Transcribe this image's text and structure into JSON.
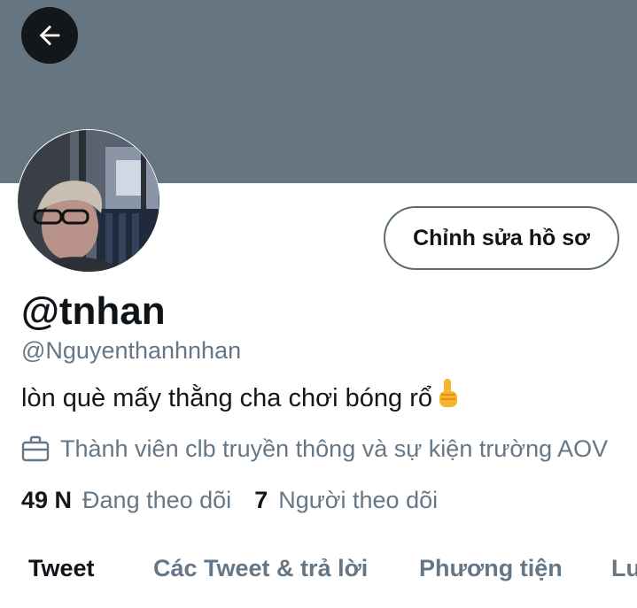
{
  "header": {
    "banner_color": "#66757f",
    "back_icon": "arrow-left-icon"
  },
  "profile": {
    "avatar_alt": "profile-photo",
    "edit_button_label": "Chỉnh sửa hồ sơ",
    "display_name": "@tnhan",
    "handle": "@Nguyenthanhnhan",
    "bio": "lòn què mấy thằng cha chơi bóng rổ",
    "bio_emoji": "👆",
    "job_icon": "briefcase-icon",
    "job": "Thành viên clb truyền thông và sự kiện trường AOV",
    "following_count": "49 N",
    "following_label": "Đang theo dõi",
    "followers_count": "7",
    "followers_label": "Người theo dõi"
  },
  "tabs": [
    {
      "label": "Tweet",
      "active": true
    },
    {
      "label": "Các Tweet & trả lời",
      "active": false
    },
    {
      "label": "Phương tiện",
      "active": false
    },
    {
      "label": "Lu",
      "active": false
    }
  ],
  "colors": {
    "text_primary": "#0f1419",
    "text_secondary": "#657786",
    "button_border": "#5b6b76"
  }
}
